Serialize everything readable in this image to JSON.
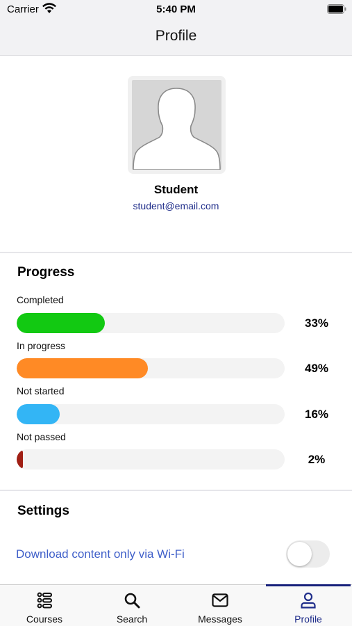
{
  "status_bar": {
    "carrier": "Carrier",
    "time": "5:40 PM"
  },
  "nav": {
    "title": "Profile"
  },
  "profile": {
    "name": "Student",
    "email": "student@email.com"
  },
  "progress": {
    "title": "Progress",
    "items": [
      {
        "label": "Completed",
        "percent_text": "33%",
        "value": 0.33,
        "color": "#12c912"
      },
      {
        "label": "In progress",
        "percent_text": "49%",
        "value": 0.49,
        "color": "#ff8a25"
      },
      {
        "label": "Not started",
        "percent_text": "16%",
        "value": 0.16,
        "color": "#33b5f5"
      },
      {
        "label": "Not passed",
        "percent_text": "2%",
        "value": 0.02,
        "color": "#a01f14"
      }
    ]
  },
  "settings": {
    "title": "Settings",
    "wifi_only_label": "Download content only via Wi-Fi",
    "wifi_only_enabled": false
  },
  "tabs": [
    {
      "label": "Courses",
      "icon": "courses-icon",
      "active": false
    },
    {
      "label": "Search",
      "icon": "search-icon",
      "active": false
    },
    {
      "label": "Messages",
      "icon": "messages-icon",
      "active": false
    },
    {
      "label": "Profile",
      "icon": "profile-icon",
      "active": true
    }
  ],
  "colors": {
    "accent": "#1f2d8a",
    "link": "#3f5fc9"
  }
}
